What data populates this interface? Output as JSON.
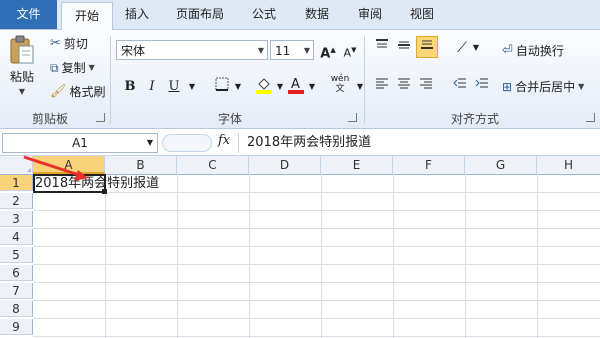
{
  "tabs": [
    "文件",
    "开始",
    "插入",
    "页面布局",
    "公式",
    "数据",
    "审阅",
    "视图"
  ],
  "clipboard": {
    "paste_label": "粘贴",
    "cut_label": "剪切",
    "copy_label": "复制",
    "format_painter_label": "格式刷",
    "group_label": "剪贴板"
  },
  "font": {
    "font_name": "宋体",
    "font_size": "11",
    "bold": "B",
    "italic": "I",
    "underline": "U",
    "group_label": "字体"
  },
  "alignment": {
    "wrap_text_label": "自动换行",
    "merge_center_label": "合并后居中",
    "group_label": "对齐方式"
  },
  "formula_bar": {
    "name_box": "A1",
    "fx": "fx",
    "content": "2018年两会特别报道"
  },
  "grid": {
    "columns": [
      "A",
      "B",
      "C",
      "D",
      "E",
      "F",
      "G",
      "H"
    ],
    "rows": [
      "1",
      "2",
      "3",
      "4",
      "5",
      "6",
      "7",
      "8",
      "9"
    ],
    "cell_A1": "2018年两会特别报道"
  },
  "colors": {
    "file_tab": "#2f6fb5",
    "selected_header": "#f9d27a",
    "arrow": "#e8312a",
    "font_color_bar": "#e02020",
    "fill_color_bar": "#ffff00"
  }
}
